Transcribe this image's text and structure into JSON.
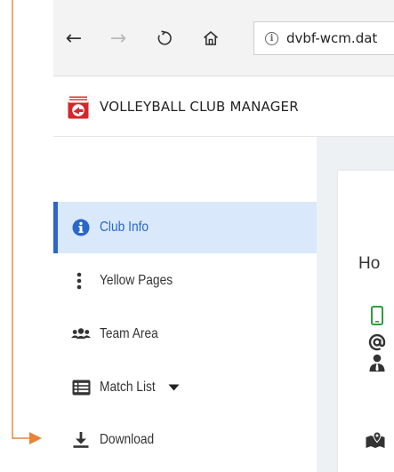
{
  "browser": {
    "url": "dvbf-wcm.dat",
    "icons": [
      "back-icon",
      "forward-icon",
      "refresh-icon",
      "home-icon",
      "site-info-icon"
    ]
  },
  "app": {
    "title": "VOLLEYBALL CLUB MANAGER",
    "logo": "volleyball-club-logo"
  },
  "sidebar": {
    "items": [
      {
        "label": "Club Info",
        "icon": "info-circle-icon",
        "active": true
      },
      {
        "label": "Yellow Pages",
        "icon": "vertical-ellipsis-icon",
        "active": false
      },
      {
        "label": "Team Area",
        "icon": "users-icon",
        "active": false
      },
      {
        "label": "Match List",
        "icon": "list-alt-icon",
        "active": false,
        "dropdown": "caret-down-icon"
      },
      {
        "label": "Download",
        "icon": "download-icon",
        "active": false
      }
    ]
  },
  "content": {
    "heading": "Ho",
    "icons": [
      "mobile-phone-icon",
      "at-sign-icon",
      "user-tie-icon",
      "map-location-icon"
    ]
  },
  "colors": {
    "active_background": "#d9e8fb",
    "active_accent": "#2a67c9",
    "annotation_arrow": "#e8833a",
    "content_background": "#eef1f4",
    "logo_red": "#d6252b",
    "phone_green": "#2e9e3e"
  }
}
